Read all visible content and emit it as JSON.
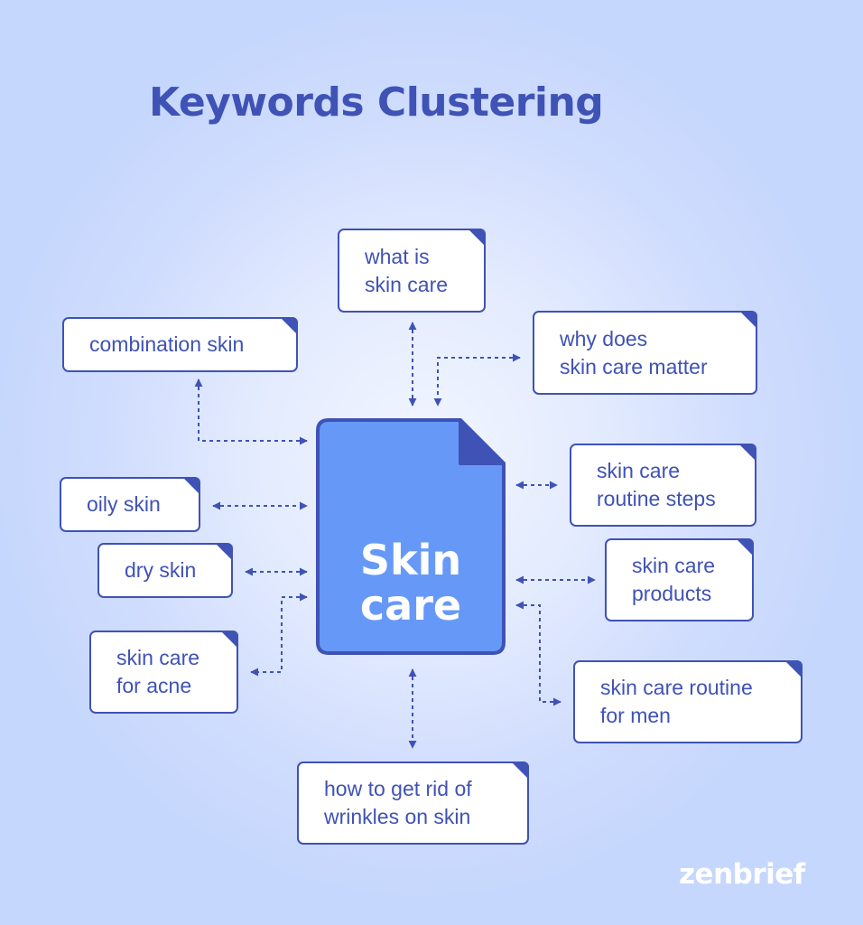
{
  "title": "Keywords Clustering",
  "central": {
    "line1": "Skin",
    "line2": "care",
    "fill_color": "#6699f7",
    "border_color": "#3f52b5"
  },
  "keywords": [
    {
      "id": "what-is-skin-care",
      "lines": [
        "what is",
        "skin care"
      ]
    },
    {
      "id": "why-does-skin-care-matter",
      "lines": [
        "why does",
        "skin care matter"
      ]
    },
    {
      "id": "combination-skin",
      "lines": [
        "combination skin"
      ]
    },
    {
      "id": "oily-skin",
      "lines": [
        "oily skin"
      ]
    },
    {
      "id": "dry-skin",
      "lines": [
        "dry skin"
      ]
    },
    {
      "id": "skin-care-for-acne",
      "lines": [
        "skin care",
        "for acne"
      ]
    },
    {
      "id": "skin-care-routine-steps",
      "lines": [
        "skin care",
        "routine steps"
      ]
    },
    {
      "id": "skin-care-products",
      "lines": [
        "skin care",
        "products"
      ]
    },
    {
      "id": "skin-care-routine-for-men",
      "lines": [
        "skin care routine",
        "for men"
      ]
    },
    {
      "id": "how-to-get-rid-of-wrinkles",
      "lines": [
        "how to get rid of",
        "wrinkles on skin"
      ]
    }
  ],
  "brand": "zenbrief",
  "colors": {
    "accent": "#3f52b5",
    "card_bg": "#ffffff",
    "background": "#c6d7fd"
  }
}
